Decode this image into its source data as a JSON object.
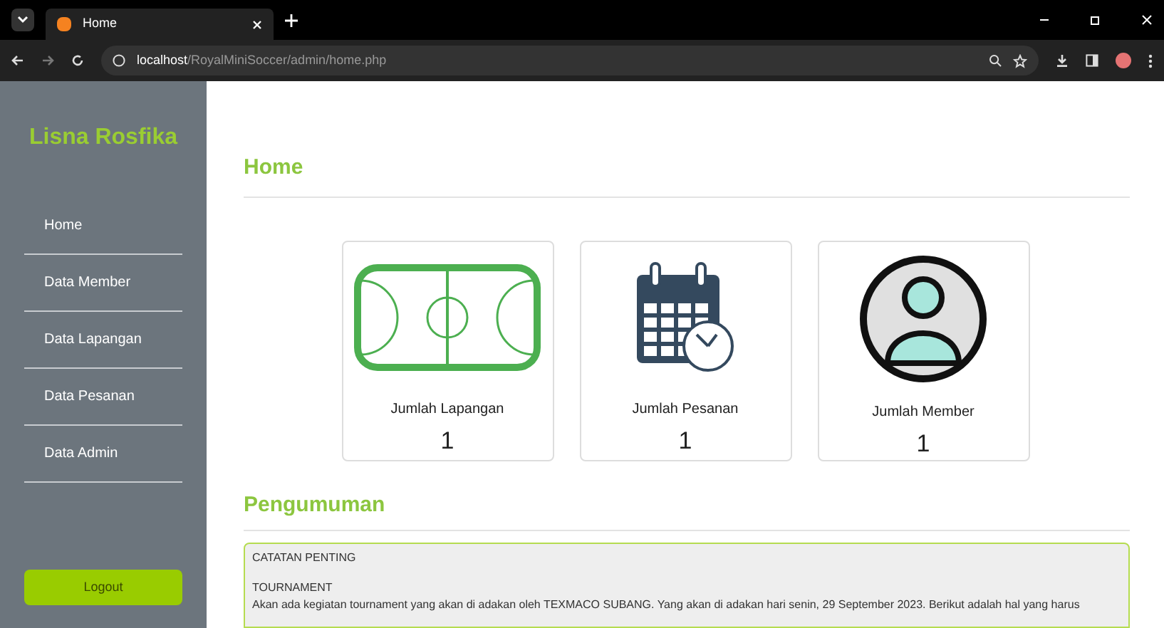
{
  "browser": {
    "tab_title": "Home",
    "url_host": "localhost",
    "url_path": "/RoyalMiniSoccer/admin/home.php"
  },
  "sidebar": {
    "brand": "Lisna Rosfika",
    "items": [
      {
        "label": "Home"
      },
      {
        "label": "Data Member"
      },
      {
        "label": "Data Lapangan"
      },
      {
        "label": "Data Pesanan"
      },
      {
        "label": "Data Admin"
      }
    ],
    "logout": "Logout"
  },
  "page_title": "Home",
  "cards": [
    {
      "kind": "field",
      "label": "Jumlah Lapangan",
      "value": "1"
    },
    {
      "kind": "calendar",
      "label": "Jumlah Pesanan",
      "value": "1"
    },
    {
      "kind": "user",
      "label": "Jumlah Member",
      "value": "1"
    }
  ],
  "announcement": {
    "title": "Pengumuman",
    "lines": [
      "CATATAN PENTING",
      "TOURNAMENT",
      "Akan ada kegiatan tournament yang akan di adakan oleh TEXMACO SUBANG. Yang akan di adakan hari senin, 29 September 2023. Berikut adalah hal yang harus"
    ]
  }
}
